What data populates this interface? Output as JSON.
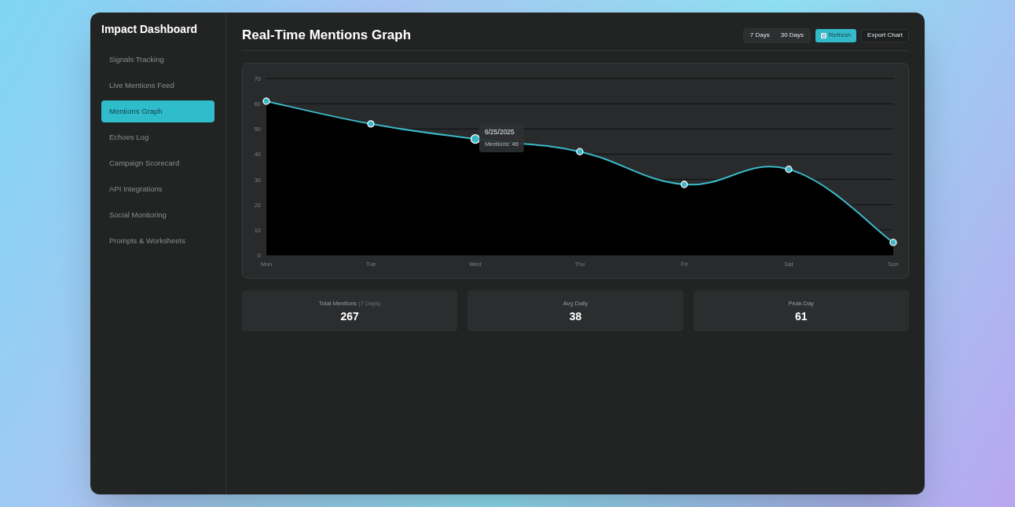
{
  "sidebar": {
    "title": "Impact Dashboard",
    "items": [
      {
        "label": "Signals Tracking",
        "selected": false
      },
      {
        "label": "Live Mentions Feed",
        "selected": false
      },
      {
        "label": "Mentions Graph",
        "selected": true
      },
      {
        "label": "Echoes Log",
        "selected": false
      },
      {
        "label": "Campaign Scorecard",
        "selected": false
      },
      {
        "label": "API Integrations",
        "selected": false
      },
      {
        "label": "Social Monitoring",
        "selected": false
      },
      {
        "label": "Prompts & Worksheets",
        "selected": false
      }
    ]
  },
  "header": {
    "title": "Real-Time Mentions Graph",
    "ranges": [
      {
        "label": "7 Days",
        "selected": false
      },
      {
        "label": "30 Days",
        "selected": false
      }
    ],
    "refresh": {
      "label": "Refresh"
    },
    "export": {
      "label": "Export Chart"
    }
  },
  "chart": {
    "chart_data": {
      "type": "area",
      "categories": [
        "Mon",
        "Tue",
        "Wed",
        "Thu",
        "Fri",
        "Sat",
        "Sun"
      ],
      "series": [
        {
          "color": "#3bb8c8",
          "values": [
            61,
            52,
            46,
            41,
            28,
            34,
            5
          ]
        }
      ],
      "ylim": [
        0,
        70
      ],
      "yticks": [
        0,
        10,
        20,
        30,
        40,
        50,
        60,
        70
      ],
      "grid": true
    },
    "points": [
      {
        "hovered": false
      },
      {
        "hovered": false
      },
      {
        "hovered": true
      },
      {
        "hovered": false
      },
      {
        "hovered": false
      },
      {
        "hovered": false
      },
      {
        "hovered": false
      }
    ],
    "tooltip": {
      "date": "6/25/2025",
      "text": "Mentions: 46"
    }
  },
  "stats": [
    {
      "label": "Total Mentions",
      "note": "(7 Days)",
      "value": "267"
    },
    {
      "label": "Avg Daily",
      "value": "38"
    },
    {
      "label": "Peak Day",
      "value": "61"
    }
  ]
}
